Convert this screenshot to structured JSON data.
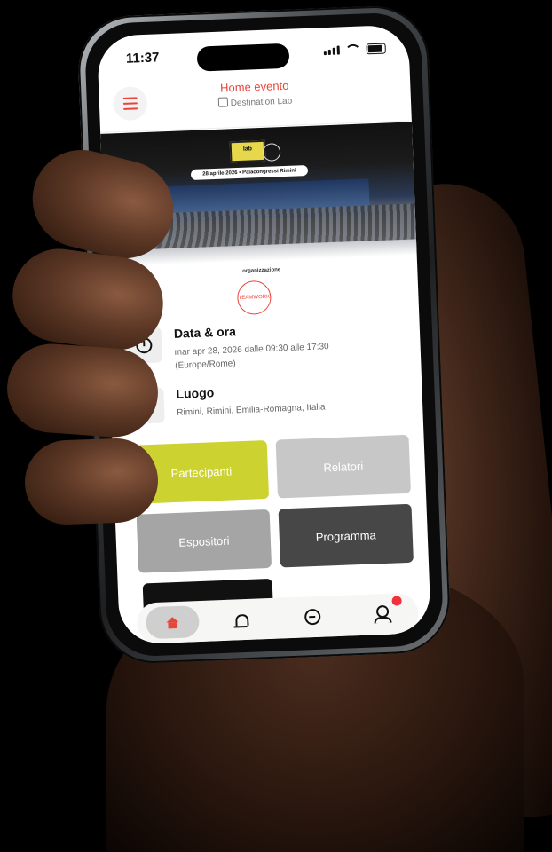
{
  "status_bar": {
    "time": "11:37"
  },
  "header": {
    "title": "Home evento",
    "subtitle": "Destination Lab"
  },
  "banner": {
    "logo_text": "lab",
    "date_pill": "28 aprile 2026 • Palacongressi Rimini"
  },
  "organizer": {
    "label": "organizzazione",
    "logo_text": "TEAMWORK"
  },
  "event_info": {
    "datetime": {
      "title": "Data & ora",
      "line1": "mar apr 28, 2026 dalle 09:30 alle 17:30",
      "line2": "(Europe/Rome)"
    },
    "location": {
      "title": "Luogo",
      "line1": "Rimini, Rimini, Emilia-Romagna, Italia"
    }
  },
  "tiles": [
    {
      "label": "Partecipanti",
      "color": "#ccd230"
    },
    {
      "label": "Relatori",
      "color": "#c7c7c7"
    },
    {
      "label": "Espositori",
      "color": "#a5a5a5"
    },
    {
      "label": "Programma",
      "color": "#474747"
    }
  ],
  "tabbar": {
    "items": [
      "home-icon",
      "bell-icon",
      "chat-icon",
      "user-icon"
    ],
    "active": "home-icon"
  },
  "colors": {
    "accent": "#e8463a",
    "notification": "#f0303a"
  }
}
